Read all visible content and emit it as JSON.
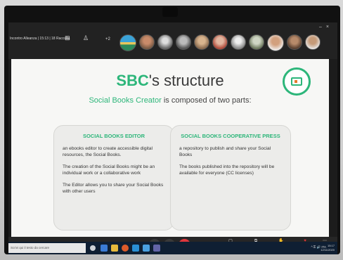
{
  "meeting": {
    "title": "Incontro Alleanza | 15:13 | 18 Raccolta",
    "participants_more": "+2"
  },
  "slide": {
    "title_accent": "SBC",
    "title_rest": "'s structure",
    "subtitle_accent": "Social Books Creator",
    "subtitle_rest": " is composed of two parts:",
    "left_card": {
      "title": "SOCIAL BOOKS EDITOR",
      "paragraphs": [
        "an ebooks editor to create accessible digital resources, the Social Books.",
        "The creation of the Social Books might be an individual work or a collaborative work",
        "The Editor allows you to share your Social Books with other users"
      ]
    },
    "right_card": {
      "title": "SOCIAL BOOKS COOPERATIVE PRESS",
      "paragraphs": [
        "a repository to publish and share your Social Books",
        "The books published into the repository will be available for everyone (CC licenses)"
      ]
    }
  },
  "toolbar": {
    "chat": "Chat",
    "breakout": "Condividi schermo",
    "raise_hand": "Alza la mano",
    "reactions": "Reazioni",
    "more": "Altro"
  },
  "taskbar": {
    "search_placeholder": "Scrivi qui il testo da cercare",
    "tray_text": "^ ⚿ 🔊 ITA",
    "time": "15:17",
    "date": "12/11/2020"
  }
}
